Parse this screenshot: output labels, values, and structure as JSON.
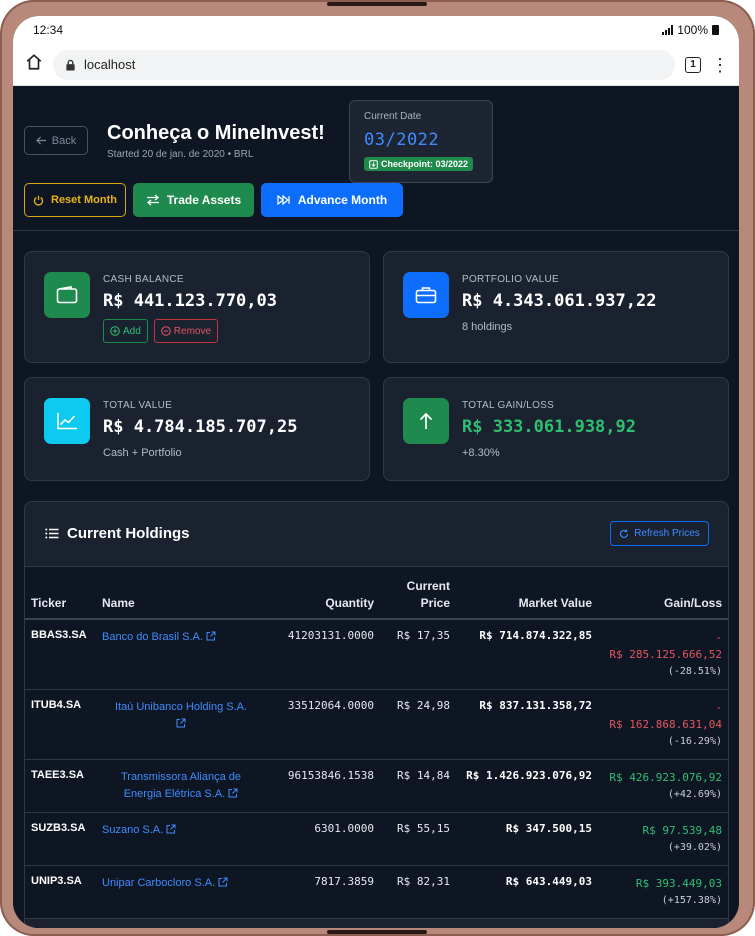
{
  "status": {
    "time": "12:34",
    "battery": "100%"
  },
  "browser": {
    "url": "localhost",
    "tabs": "1"
  },
  "header": {
    "back_label": "Back",
    "title": "Conheça o MineInvest!",
    "subtitle": "Started 20 de jan. de 2020 • BRL"
  },
  "date_card": {
    "label": "Current Date",
    "value": "03/2022",
    "checkpoint": "Checkpoint: 03/2022"
  },
  "actions": {
    "reset": "Reset Month",
    "trade": "Trade Assets",
    "advance": "Advance Month"
  },
  "colors": {
    "accent_blue": "#0d6efd",
    "green": "#1f8a4d",
    "red": "#e35660",
    "yellow": "#e7b417",
    "cyan": "#0dcaf0"
  },
  "cards": {
    "cash": {
      "label": "CASH BALANCE",
      "value": "R$ 441.123.770,03",
      "add": "Add",
      "remove": "Remove",
      "icon": "wallet-icon"
    },
    "portfolio": {
      "label": "PORTFOLIO VALUE",
      "value": "R$ 4.343.061.937,22",
      "sub": "8 holdings",
      "icon": "briefcase-icon"
    },
    "total": {
      "label": "TOTAL VALUE",
      "value": "R$ 4.784.185.707,25",
      "sub": "Cash + Portfolio",
      "icon": "chart-line-icon"
    },
    "gain": {
      "label": "TOTAL GAIN/LOSS",
      "value": "R$ 333.061.938,92",
      "sub": "+8.30%",
      "icon": "arrow-up-icon"
    }
  },
  "holdings": {
    "title": "Current Holdings",
    "refresh": "Refresh Prices",
    "columns": {
      "ticker": "Ticker",
      "name": "Name",
      "quantity": "Quantity",
      "price_1": "Current",
      "price_2": "Price",
      "market_value": "Market Value",
      "gain_loss": "Gain/Loss"
    },
    "rows": [
      {
        "ticker": "BBAS3.SA",
        "name": "Banco do Brasil S.A.",
        "quantity": "41203131.0000",
        "price": "R$ 17,35",
        "market_value": "R$ 714.874.322,85",
        "gain_sign": "-",
        "gain": "R$ 285.125.666,52",
        "pct": "(-28.51%)"
      },
      {
        "ticker": "ITUB4.SA",
        "name": "Itaú Unibanco Holding S.A.",
        "quantity": "33512064.0000",
        "price": "R$ 24,98",
        "market_value": "R$ 837.131.358,72",
        "gain_sign": "-",
        "gain": "R$ 162.868.631,04",
        "pct": "(-16.29%)"
      },
      {
        "ticker": "TAEE3.SA",
        "name": "Transmissora Aliança de Energia Elétrica S.A.",
        "quantity": "96153846.1538",
        "price": "R$ 14,84",
        "market_value": "R$ 1.426.923.076,92",
        "gain_sign": "",
        "gain": "R$ 426.923.076,92",
        "pct": "(+42.69%)"
      },
      {
        "ticker": "SUZB3.SA",
        "name": "Suzano S.A.",
        "quantity": "6301.0000",
        "price": "R$ 55,15",
        "market_value": "R$ 347.500,15",
        "gain_sign": "",
        "gain": "R$ 97.539,48",
        "pct": "(+39.02%)"
      },
      {
        "ticker": "UNIP3.SA",
        "name": "Unipar Carbocloro S.A.",
        "quantity": "7817.3859",
        "price": "R$ 82,31",
        "market_value": "R$ 643.449,03",
        "gain_sign": "",
        "gain": "R$ 393.449,03",
        "pct": "(+157.38%)"
      }
    ]
  }
}
